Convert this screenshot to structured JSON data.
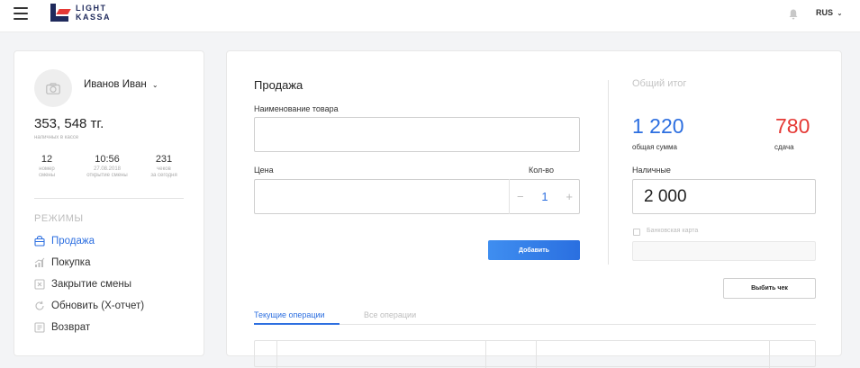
{
  "header": {
    "logo_line1": "LIGHT",
    "logo_line2": "KASSA",
    "language": "RUS",
    "icons": [
      "menu-icon",
      "bell-icon",
      "chevron-down-icon"
    ]
  },
  "profile": {
    "name": "Иванов Иван",
    "balance": "353, 548 тг.",
    "balance_caption": "наличных в кассе",
    "stats": [
      {
        "value": "12",
        "caption1": "номер",
        "caption2": "смены"
      },
      {
        "value": "10:56",
        "caption1": "27.08.2018",
        "caption2": "открытие смены"
      },
      {
        "value": "231",
        "caption1": "чеков",
        "caption2": "за сегодня"
      }
    ]
  },
  "modes": {
    "title": "РЕЖИМЫ",
    "items": [
      {
        "label": "Продажа",
        "icon": "cart-icon",
        "active": true
      },
      {
        "label": "Покупка",
        "icon": "chart-icon",
        "active": false
      },
      {
        "label": "Закрытие смены",
        "icon": "close-box-icon",
        "active": false
      },
      {
        "label": "Обновить (X-отчет)",
        "icon": "refresh-icon",
        "active": false
      },
      {
        "label": "Возврат",
        "icon": "return-icon",
        "active": false
      }
    ]
  },
  "sale": {
    "title": "Продажа",
    "product_label": "Наименование товара",
    "product_value": "",
    "price_label": "Цена",
    "price_value": "",
    "qty_label": "Кол-во",
    "qty_value": "1",
    "add_button": "Добавить"
  },
  "totals": {
    "title": "Общий итог",
    "sum_value": "1 220",
    "sum_caption": "общая сумма",
    "change_value": "780",
    "change_caption": "сдача",
    "cash_label": "Наличные",
    "cash_value": "2 000",
    "bank_card_label": "Банковская карта",
    "print_button": "Выбить чек"
  },
  "tabs": [
    {
      "label": "Текущие операции",
      "active": true
    },
    {
      "label": "Все операции",
      "active": false
    }
  ],
  "colors": {
    "accent": "#2d6fe0",
    "change": "#e53935",
    "brand": "#1f2a5c"
  }
}
